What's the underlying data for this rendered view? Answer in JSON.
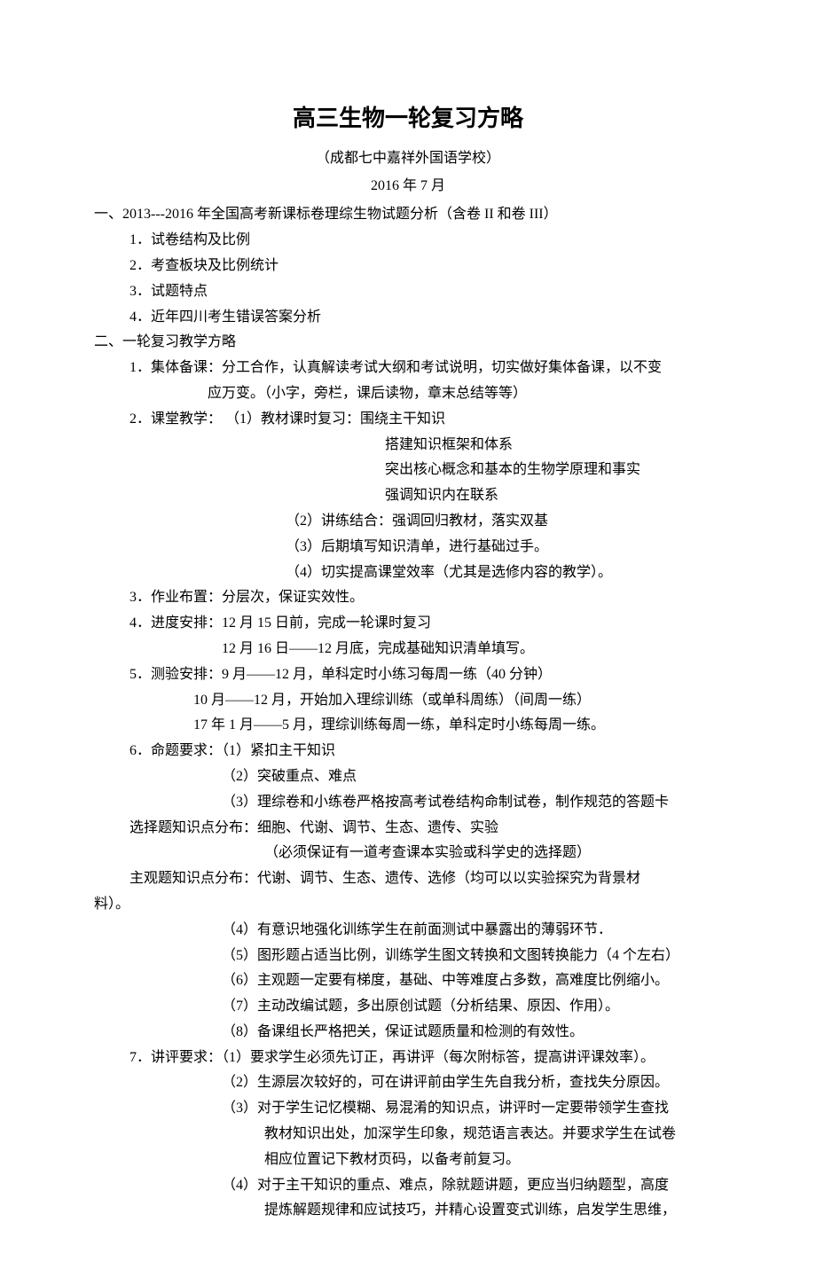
{
  "title": "高三生物一轮复习方略",
  "subtitle": "（成都七中嘉祥外国语学校）",
  "date": "2016 年 7 月",
  "sec1": {
    "head": "一、2013---2016 年全国高考新课标卷理综生物试题分析（含卷 II 和卷 III）",
    "i1": "1．试卷结构及比例",
    "i2": "2．考查板块及比例统计",
    "i3": "3．试题特点",
    "i4": "4．近年四川考生错误答案分析"
  },
  "sec2": {
    "head": "二、一轮复习教学方略",
    "p1a": "1．集体备课：分工合作，认真解读考试大纲和考试说明，切实做好集体备课，以不变",
    "p1b": "应万变。（小字，旁栏，课后读物，章末总结等等）",
    "p2a": "2．课堂教学：   （1）教材课时复习：围绕主干知识",
    "p2b": "搭建知识框架和体系",
    "p2c": "突出核心概念和基本的生物学原理和事实",
    "p2d": "强调知识内在联系",
    "p2e": "（2）讲练结合：强调回归教材，落实双基",
    "p2f": "（3）后期填写知识清单，进行基础过手。",
    "p2g": "（4）切实提高课堂效率（尤其是选修内容的教学）。",
    "p3": "3．作业布置：分层次，保证实效性。",
    "p4a": "4．进度安排：12 月 15 日前，完成一轮课时复习",
    "p4b": "12 月 16 日——12 月底，完成基础知识清单填写。",
    "p5a": "5．测验安排：9 月——12 月，单科定时小练习每周一练（40 分钟）",
    "p5b": "10 月——12 月，开始加入理综训练（或单科周练）（间周一练）",
    "p5c": "17 年 1 月——5 月，理综训练每周一练，单科定时小练每周一练。",
    "p6a": "6．命题要求：（1）紧扣主干知识",
    "p6b": "（2）突破重点、难点",
    "p6c": "（3）理综卷和小练卷严格按高考试卷结构命制试卷，制作规范的答题卡",
    "p6d": "选择题知识点分布：细胞、代谢、调节、生态、遗传、实验",
    "p6e": "（必须保证有一道考查课本实验或科学史的选择题）",
    "p6f": "主观题知识点分布：代谢、调节、生态、遗传、选修（均可以以实验探究为背景材",
    "p6f2": "料）。",
    "p6g": "（4）有意识地强化训练学生在前面测试中暴露出的薄弱环节．",
    "p6h": "（5）图形题占适当比例，训练学生图文转换和文图转换能力（4 个左右）",
    "p6i": "（6）主观题一定要有梯度，基础、中等难度占多数，高难度比例缩小。",
    "p6j": "（7）主动改编试题，多出原创试题（分析结果、原因、作用）。",
    "p6k": "（8）备课组长严格把关，保证试题质量和检测的有效性。",
    "p7a": "7．讲评要求：（1）要求学生必须先订正，再讲评（每次附标答，提高讲评课效率）。",
    "p7b": "（2）生源层次较好的，可在讲评前由学生先自我分析，查找失分原因。",
    "p7c1": "（3）对于学生记忆模糊、易混淆的知识点，讲评时一定要带领学生查找",
    "p7c2": "教材知识出处，加深学生印象，规范语言表达。并要求学生在试卷",
    "p7c3": "相应位置记下教材页码，以备考前复习。",
    "p7d1": "（4）对于主干知识的重点、难点，除就题讲题，更应当归纳题型，高度",
    "p7d2": "提炼解题规律和应试技巧，并精心设置变式训练，启发学生思维，"
  }
}
